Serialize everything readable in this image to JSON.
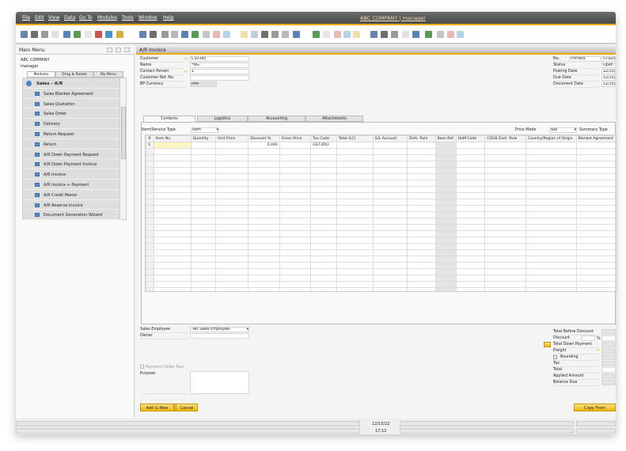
{
  "menubar": {
    "items": [
      "File",
      "Edit",
      "View",
      "Data",
      "Go To",
      "Modules",
      "Tools",
      "Window",
      "Help"
    ],
    "title": "ABC COMPANY | manager"
  },
  "toolbar": {
    "icons": [
      "preview-icon",
      "print-icon",
      "email-icon",
      "sms-icon",
      "fax-icon",
      "excel-icon",
      "word-icon",
      "pdf-icon",
      "launch-icon",
      "lock-icon",
      "find-icon",
      "add-icon",
      "first-record-icon",
      "previous-record-icon",
      "next-record-icon",
      "last-record-icon",
      "refresh-icon",
      "filter-icon",
      "sort-icon",
      "base-document-icon",
      "target-document-icon",
      "gross-profit-icon",
      "payment-means-icon",
      "volume-weight-icon",
      "settings-icon",
      "draw-icon",
      "new-doc-icon",
      "edit-doc-icon",
      "message-icon",
      "message2-icon",
      "calendar-icon",
      "alert-icon",
      "report-icon",
      "tree-icon",
      "user-icon",
      "window-icon",
      "help-icon",
      "doc-icon",
      "doc2-icon"
    ],
    "accent": "#f0ab00"
  },
  "main_menu": {
    "title": "Main Menu",
    "company": "ABC COMPANY",
    "user": "manager",
    "tabs": [
      "Modules",
      "Drag & Relate",
      "My Menu"
    ],
    "section": "Sales - A/R",
    "items": [
      "Sales Blanket Agreement",
      "Sales Quotation",
      "Sales Order",
      "Delivery",
      "Return Request",
      "Return",
      "A/R Down Payment Request",
      "A/R Down Payment Invoice",
      "A/R Invoice",
      "A/R Invoice + Payment",
      "A/R Credit Memo",
      "A/R Reserve Invoice",
      "Document Generation Wizard"
    ]
  },
  "form": {
    "title": "A/R Invoice",
    "header_left": [
      {
        "label": "Customer",
        "value": "CS0385"
      },
      {
        "label": "Name",
        "value": "*NG"
      },
      {
        "label": "Contact Person",
        "value": "1"
      },
      {
        "label": "Customer Ref. No.",
        "value": ""
      },
      {
        "label": "BP Currency",
        "value": "PHP"
      }
    ],
    "header_right": {
      "no_label": "No.",
      "series": "Primary",
      "no_value": "57920",
      "rows": [
        {
          "label": "Status",
          "value": "Open"
        },
        {
          "label": "Posting Date",
          "value": "12/15/2"
        },
        {
          "label": "Due Date",
          "value": "12/15/2"
        },
        {
          "label": "Document Date",
          "value": "12/15/2"
        }
      ]
    },
    "tabs": [
      "Contents",
      "Logistics",
      "Accounting",
      "Attachments"
    ],
    "item_type_label": "Item/Service Type",
    "item_type": "Item",
    "price_mode_label": "Price Mode",
    "price_mode": "Net",
    "summary_type_label": "Summary Type",
    "columns": [
      "#",
      "Item No.",
      "Quantity",
      "Unit Price",
      "Discount %",
      "Gross Price",
      "Tax Code",
      "Total (LC)",
      "G/L Account",
      "Distr. Rule",
      "Base Ref.",
      "UoM Code",
      "COGS Distr. Rule",
      "Country/Region of Origin",
      "Blanket Agreement"
    ],
    "rows": [
      [
        "1",
        "",
        "",
        "",
        "0.000",
        "",
        "GST-ZRO",
        "",
        "",
        "",
        "",
        "",
        "",
        "",
        ""
      ]
    ],
    "sales_employee_label": "Sales Employee",
    "sales_employee": "-No Sales Employee-",
    "owner_label": "Owner",
    "owner": "",
    "payment_order_run": "Payment Order Run",
    "purpose_label": "Purpose",
    "totals": [
      "Total Before Discount",
      "Discount",
      "Total Down Payment",
      "Freight",
      "Rounding",
      "Tax",
      "Total",
      "Applied Amount",
      "Balance Due"
    ],
    "percent": "%",
    "buttons": {
      "add_new": "Add & New",
      "cancel": "Cancel",
      "copy_from": "Copy From"
    }
  },
  "status": {
    "date": "12/15/22",
    "time": "17:12"
  }
}
